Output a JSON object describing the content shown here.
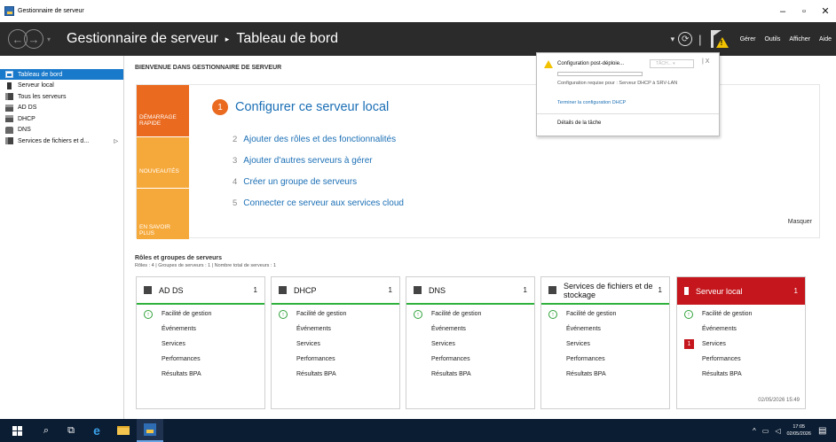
{
  "window": {
    "title": "Gestionnaire de serveur",
    "controls": [
      "–",
      "▫",
      "✕"
    ]
  },
  "header": {
    "app_name": "Gestionnaire de serveur",
    "separator": "▸",
    "page": "Tableau de bord",
    "menu": [
      "Gérer",
      "Outils",
      "Afficher",
      "Aide"
    ]
  },
  "sidebar": {
    "items": [
      {
        "label": "Tableau de bord",
        "active": true
      },
      {
        "label": "Serveur local"
      },
      {
        "label": "Tous les serveurs"
      },
      {
        "label": "AD DS"
      },
      {
        "label": "DHCP"
      },
      {
        "label": "DNS"
      },
      {
        "label": "Services de fichiers et d...",
        "expand": "▷"
      }
    ]
  },
  "welcome": {
    "title": "BIENVENUE DANS GESTIONNAIRE DE SERVEUR",
    "tiles": [
      "DÉMARRAGE RAPIDE",
      "NOUVEAUTÉS",
      "EN SAVOIR PLUS"
    ],
    "steps": [
      {
        "n": "1",
        "label": "Configurer ce serveur local"
      },
      {
        "n": "2",
        "label": "Ajouter des rôles et des fonctionnalités"
      },
      {
        "n": "3",
        "label": "Ajouter d'autres serveurs à gérer"
      },
      {
        "n": "4",
        "label": "Créer un groupe de serveurs"
      },
      {
        "n": "5",
        "label": "Connecter ce serveur aux services cloud"
      }
    ],
    "hide_label": "Masquer"
  },
  "roles": {
    "title": "Rôles et groupes de serveurs",
    "subtitle": "Rôles : 4  |  Groupes de serveurs : 1  |  Nombre total de serveurs : 1",
    "cards": [
      {
        "name": "AD DS",
        "count": "1",
        "rows": [
          "Facilité de gestion",
          "Événements",
          "Services",
          "Performances",
          "Résultats BPA"
        ]
      },
      {
        "name": "DHCP",
        "count": "1",
        "rows": [
          "Facilité de gestion",
          "Événements",
          "Services",
          "Performances",
          "Résultats BPA"
        ]
      },
      {
        "name": "DNS",
        "count": "1",
        "rows": [
          "Facilité de gestion",
          "Événements",
          "Services",
          "Performances",
          "Résultats BPA"
        ]
      },
      {
        "name": "Services de fichiers et de stockage",
        "count": "1",
        "rows": [
          "Facilité de gestion",
          "Événements",
          "Services",
          "Performances",
          "Résultats BPA"
        ]
      },
      {
        "name": "Serveur local",
        "count": "1",
        "rows": [
          "Facilité de gestion",
          "Événements",
          "Services",
          "Performances",
          "Résultats BPA"
        ],
        "services_alert": "1",
        "timestamp": "02/05/2026 15:49"
      }
    ]
  },
  "notification": {
    "title": "Configuration post-déploie...",
    "task_label": "TÂCH...",
    "close": "X",
    "description": "Configuration requise pour : Serveur DHCP à SRV-LAN",
    "link": "Terminer la configuration DHCP",
    "details": "Détails de la tâche"
  },
  "taskbar": {
    "time": "17:05",
    "date": "02/05/2026"
  }
}
